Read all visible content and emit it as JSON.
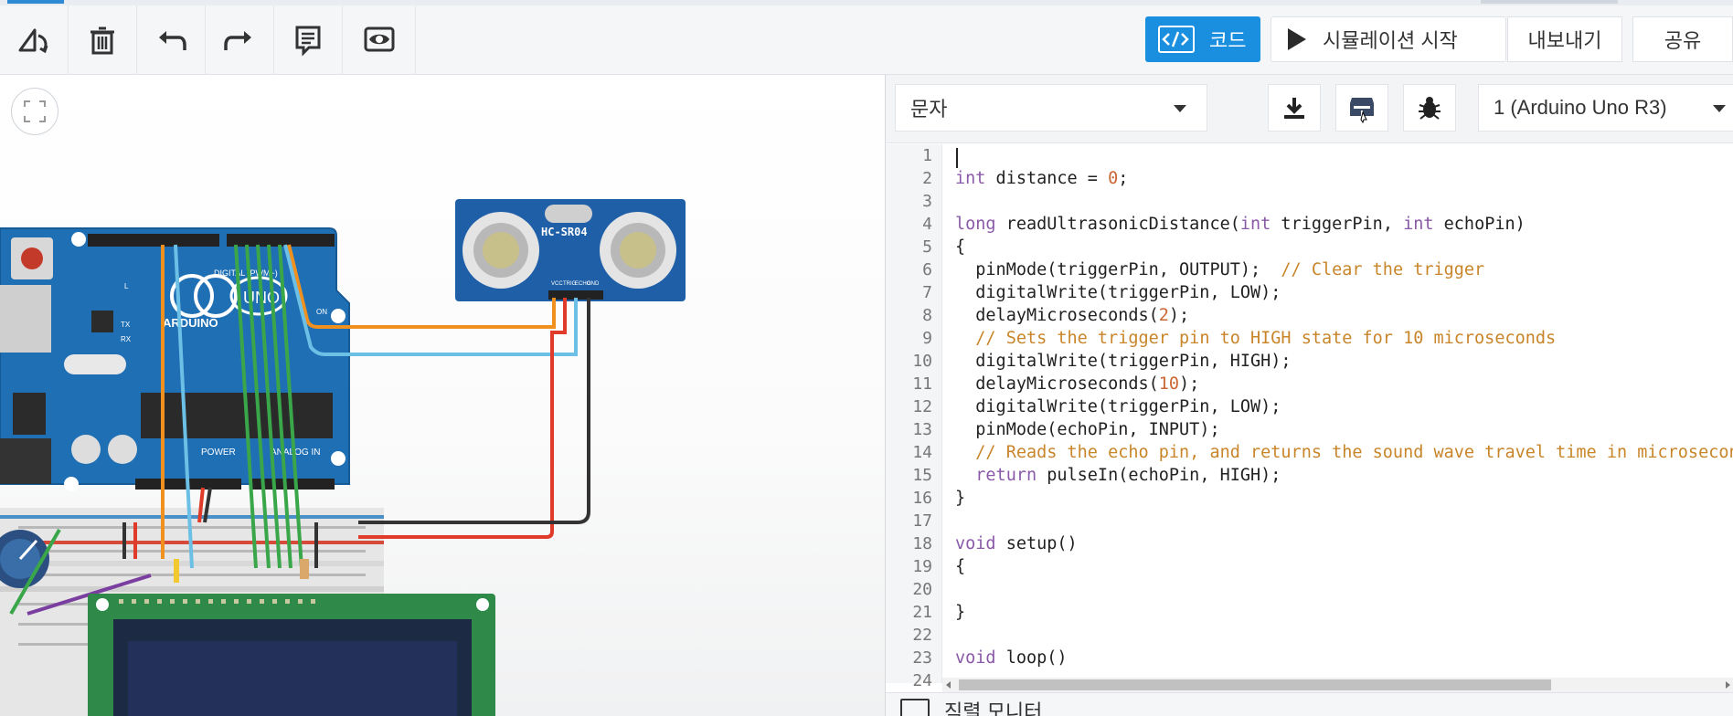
{
  "toolbar": {
    "code_label": "코드",
    "simulate_label": "시뮬레이션 시작",
    "export_label": "내보내기",
    "share_label": "공유"
  },
  "code_panel": {
    "mode": "문자",
    "device": "1 (Arduino Uno R3)",
    "serial_monitor_label": "직렬 모니터"
  },
  "code_lines": [
    "",
    "int distance = 0;",
    "",
    "long readUltrasonicDistance(int triggerPin, int echoPin)",
    "{",
    "  pinMode(triggerPin, OUTPUT);  // Clear the trigger",
    "  digitalWrite(triggerPin, LOW);",
    "  delayMicroseconds(2);",
    "  // Sets the trigger pin to HIGH state for 10 microseconds",
    "  digitalWrite(triggerPin, HIGH);",
    "  delayMicroseconds(10);",
    "  digitalWrite(triggerPin, LOW);",
    "  pinMode(echoPin, INPUT);",
    "  // Reads the echo pin, and returns the sound wave travel time in microseconds",
    "  return pulseIn(echoPin, HIGH);",
    "}",
    "",
    "void setup()",
    "{",
    "",
    "}",
    "",
    "void loop()",
    ""
  ],
  "line_numbers": [
    "1",
    "2",
    "3",
    "4",
    "5",
    "6",
    "7",
    "8",
    "9",
    "10",
    "11",
    "12",
    "13",
    "14",
    "15",
    "16",
    "17",
    "18",
    "19",
    "20",
    "21",
    "22",
    "23",
    "24"
  ],
  "circuit": {
    "sensor_label": "HC-SR04",
    "sensor_pins": [
      "VCC",
      "TRIG",
      "ECHO",
      "GND"
    ],
    "board_brand": "ARDUINO",
    "board_model": "UNO",
    "digital_header": "DIGITAL (PWM~)",
    "power_header": "POWER",
    "analog_header": "ANALOG IN",
    "on_label": "ON",
    "tx_label": "TX",
    "rx_label": "RX",
    "l_label": "L"
  },
  "colors": {
    "accent": "#1a8fe0",
    "board": "#1f6fb5",
    "sensor": "#1e5fa8",
    "wire_orange": "#f0901e",
    "wire_lightblue": "#6cc0e6",
    "wire_red": "#e03a2a",
    "wire_black": "#333333",
    "wire_green": "#3aa64a",
    "comment": "#c8852a",
    "keyword": "#8a5aa8"
  },
  "icons": [
    "rotate-icon",
    "trash-icon",
    "undo-icon",
    "redo-icon",
    "notes-icon",
    "visibility-icon",
    "code-icon",
    "play-icon",
    "fit-view-icon",
    "download-icon",
    "upload-icon",
    "bug-icon",
    "serial-monitor-icon"
  ]
}
